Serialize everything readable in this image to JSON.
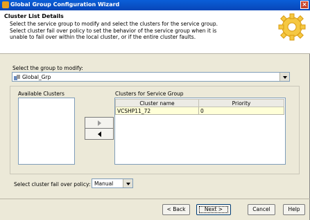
{
  "window": {
    "title": "Global Group Configuration Wizard",
    "close_label": "×"
  },
  "header": {
    "title": "Cluster List Details",
    "line1": "Select the service group to modify and select the clusters for the service group.",
    "line2": "Select cluster fail over policy to set the behavior of the service group when it is",
    "line3": "unable to fail over within the local cluster, or if the entire cluster faults."
  },
  "group_select": {
    "label": "Select the group to modify:",
    "value": "Global_Grp"
  },
  "available": {
    "label": "Available Clusters"
  },
  "service_group_clusters": {
    "label": "Clusters for Service Group",
    "columns": [
      "Cluster name",
      "Priority"
    ],
    "rows": [
      {
        "cluster": "VCSHP11_72",
        "priority": "0"
      }
    ]
  },
  "policy": {
    "label": "Select cluster fail over policy:",
    "value": "Manual"
  },
  "buttons": {
    "back": "< Back",
    "next": "Next >",
    "cancel": "Cancel",
    "help": "Help"
  },
  "colors": {
    "titlebar": "#0a5fd8",
    "row_highlight": "#ffffd8",
    "window_bg": "#ece9d8"
  }
}
